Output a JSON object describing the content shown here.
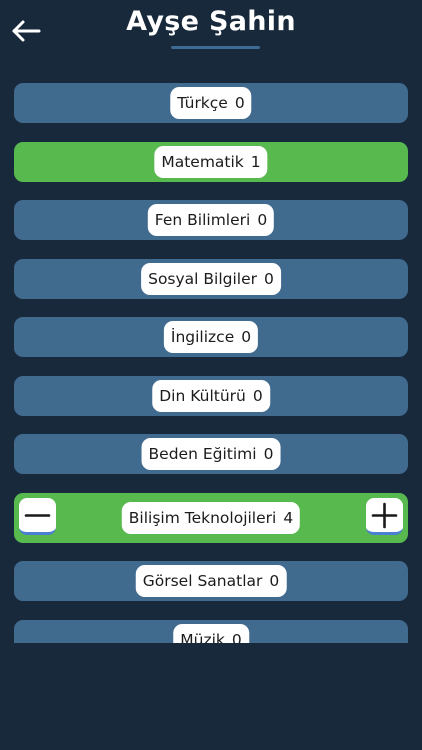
{
  "header": {
    "title": "Ayşe Şahin",
    "back_icon": "arrow-left-icon"
  },
  "colors": {
    "background": "#17293a",
    "row": "#416a8f",
    "row_selected": "#58b94f",
    "pill": "#ffffff"
  },
  "subjects": [
    {
      "name": "Türkçe",
      "count": "0",
      "selected": false
    },
    {
      "name": "Matematik",
      "count": "1",
      "selected": true
    },
    {
      "name": "Fen Bilimleri",
      "count": "0",
      "selected": false
    },
    {
      "name": "Sosyal Bilgiler",
      "count": "0",
      "selected": false
    },
    {
      "name": "İngilizce",
      "count": "0",
      "selected": false
    },
    {
      "name": "Din Kültürü",
      "count": "0",
      "selected": false
    },
    {
      "name": "Beden Eğitimi",
      "count": "0",
      "selected": false
    },
    {
      "name": "Bilişim Teknolojileri",
      "count": "4",
      "selected": true,
      "expanded": true
    },
    {
      "name": "Görsel Sanatlar",
      "count": "0",
      "selected": false
    },
    {
      "name": "Müzik",
      "count": "0",
      "selected": false
    }
  ],
  "stepper": {
    "minus_icon": "minus-icon",
    "plus_icon": "plus-icon"
  }
}
